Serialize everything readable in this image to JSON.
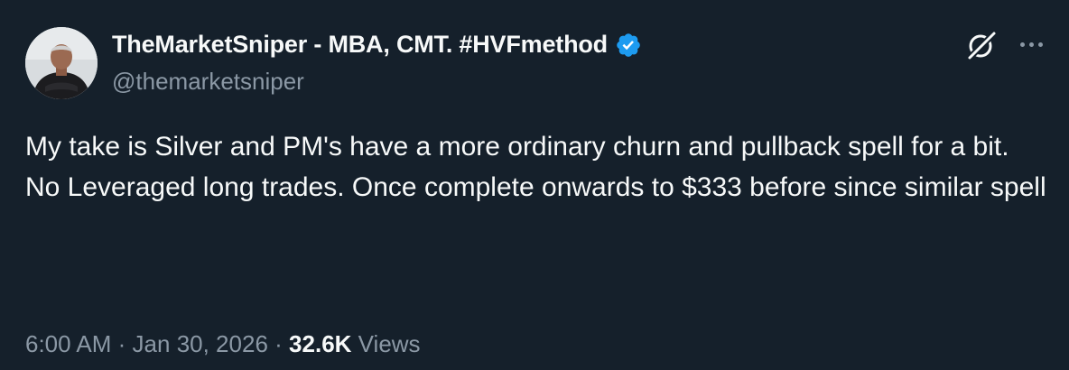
{
  "author": {
    "display_name": "TheMarketSniper - MBA, CMT. #HVFmethod",
    "handle": "@themarketsniper",
    "verified": true
  },
  "tweet": {
    "lines": [
      "My take is Silver and PM's have a more ordinary churn and pullback spell for a bit.",
      "No Leveraged long trades. Once complete onwards to $333 before since similar spell"
    ]
  },
  "meta": {
    "time": "6:00 AM",
    "separator": "·",
    "date": "Jan 30, 2026",
    "views_count": "32.6K",
    "views_label": "Views"
  },
  "icons": {
    "avatar": "avatar",
    "verified": "verified-badge-icon",
    "grok": "grok-icon",
    "more": "more-icon"
  },
  "colors": {
    "background": "#15202b",
    "text_primary": "#f7f9f9",
    "text_secondary": "#8b98a5",
    "verified_blue": "#1d9bf0"
  }
}
